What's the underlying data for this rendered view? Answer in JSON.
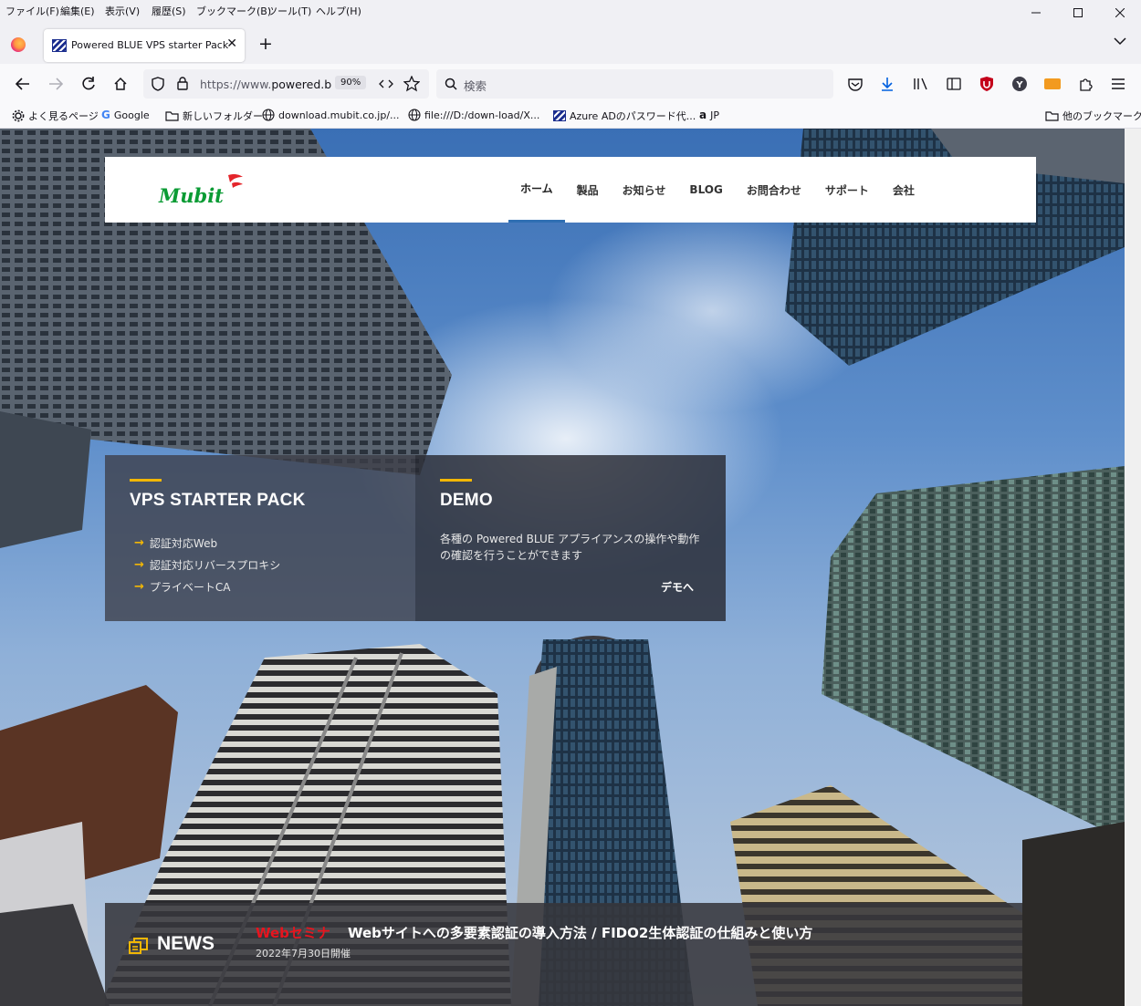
{
  "browser": {
    "menu": [
      "ファイル(F)",
      "編集(E)",
      "表示(V)",
      "履歴(S)",
      "ブックマーク(B)",
      "ツール(T)",
      "ヘルプ(H)"
    ],
    "tab_title": "Powered BLUE VPS starter Pack",
    "url_prefix": "https://www.",
    "url_domain": "powered.b",
    "zoom": "90%",
    "search_placeholder": "検索",
    "bookmarks": [
      "よく見るページ",
      "Google",
      "新しいフォルダー",
      "download.mubit.co.jp/...",
      "file:///D:/down-load/X...",
      "Azure ADのパスワード代...",
      "JP"
    ],
    "other_bookmarks": "他のブックマーク"
  },
  "site": {
    "logo_text": "Mubit",
    "nav": [
      "ホーム",
      "製品",
      "お知らせ",
      "BLOG",
      "お問合わせ",
      "サポート",
      "会社"
    ],
    "vps": {
      "title": "VPS STARTER PACK",
      "items": [
        "認証対応Web",
        "認証対応リバースプロキシ",
        "プライベートCA"
      ]
    },
    "demo": {
      "title": "DEMO",
      "text": "各種の Powered BLUE アプライアンスの操作や動作の確認を行うことができます",
      "link": "デモへ"
    },
    "news": {
      "label": "NEWS",
      "tag": "Webセミナ",
      "title": "Webサイトへの多要素認証の導入方法 / FIDO2生体認証の仕組みと使い方",
      "date": "2022年7月30日開催"
    }
  },
  "colors": {
    "accent_yellow": "#f2b705",
    "nav_active": "#2f6fb3",
    "news_tag": "#e8141e"
  }
}
